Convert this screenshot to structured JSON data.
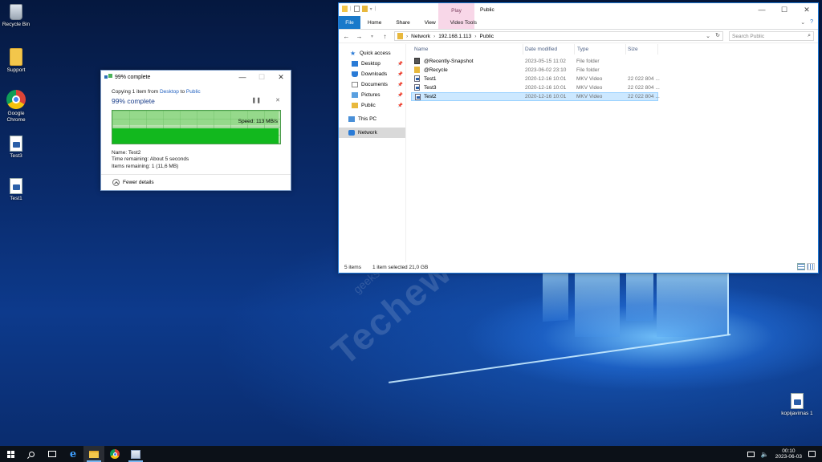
{
  "desktop": {
    "icons": [
      {
        "label": "Recycle Bin",
        "icon": "recycle-bin-icon"
      },
      {
        "label": "Support",
        "icon": "folder-icon"
      },
      {
        "label": "Google Chrome",
        "icon": "chrome-icon"
      },
      {
        "label": "Test3",
        "icon": "video-file-icon"
      },
      {
        "label": "Test1",
        "icon": "video-file-icon"
      },
      {
        "label": "kopijavimas 1",
        "icon": "document-icon"
      }
    ]
  },
  "copy_dialog": {
    "title": "99% complete",
    "copy_prefix": "Copying 1 item from ",
    "source": "Desktop",
    "to_word": " to ",
    "destination": "Public",
    "heading": "99% complete",
    "progress": 0.99,
    "speed": "Speed: 113 MB/s",
    "name_line": "Name:  Test2",
    "time_line": "Time remaining:  About 5 seconds",
    "items_line": "Items remaining:  1 (11,6 MB)",
    "fewer_details": "Fewer details"
  },
  "explorer": {
    "title": "Public",
    "contextual_tab": "Play",
    "tabs": [
      "File",
      "Home",
      "Share",
      "View",
      "Video Tools"
    ],
    "breadcrumb": [
      "Network",
      "192.168.1.113",
      "Public"
    ],
    "search_placeholder": "Search Public",
    "nav_pane": [
      {
        "label": "Quick access",
        "icon": "star-icon",
        "pinned": false
      },
      {
        "label": "Desktop",
        "icon": "desktop-icon",
        "pinned": true
      },
      {
        "label": "Downloads",
        "icon": "downloads-icon",
        "pinned": true
      },
      {
        "label": "Documents",
        "icon": "documents-icon",
        "pinned": true
      },
      {
        "label": "Pictures",
        "icon": "pictures-icon",
        "pinned": true
      },
      {
        "label": "Public",
        "icon": "folder-icon",
        "pinned": true
      },
      {
        "label": "This PC",
        "icon": "pc-icon",
        "pinned": false
      },
      {
        "label": "Network",
        "icon": "network-icon",
        "pinned": false,
        "selected": true
      }
    ],
    "columns": [
      "Name",
      "Date modified",
      "Type",
      "Size"
    ],
    "files": [
      {
        "name": "@Recently-Snapshot",
        "date": "2023-05-15 11:02",
        "type": "File folder",
        "size": "",
        "icon": "snapshot-folder-icon"
      },
      {
        "name": "@Recycle",
        "date": "2023-06-02 23:10",
        "type": "File folder",
        "size": "",
        "icon": "folder-icon"
      },
      {
        "name": "Test1",
        "date": "2020-12-16 10:01",
        "type": "MKV Video",
        "size": "22 022 804 ...",
        "icon": "video-file-icon"
      },
      {
        "name": "Test3",
        "date": "2020-12-16 10:01",
        "type": "MKV Video",
        "size": "22 022 804 ...",
        "icon": "video-file-icon"
      },
      {
        "name": "Test2",
        "date": "2020-12-16 10:01",
        "type": "MKV Video",
        "size": "22 022 804 ...",
        "icon": "video-file-icon",
        "selected": true
      }
    ],
    "status_items": "5 items",
    "status_selected": "1 item selected  21,0 GB"
  },
  "watermark": {
    "brand": "Techews.lt",
    "tagline": "geeks meet hardware and software"
  },
  "taskbar": {
    "time": "00:10",
    "date": "2023-06-03"
  }
}
